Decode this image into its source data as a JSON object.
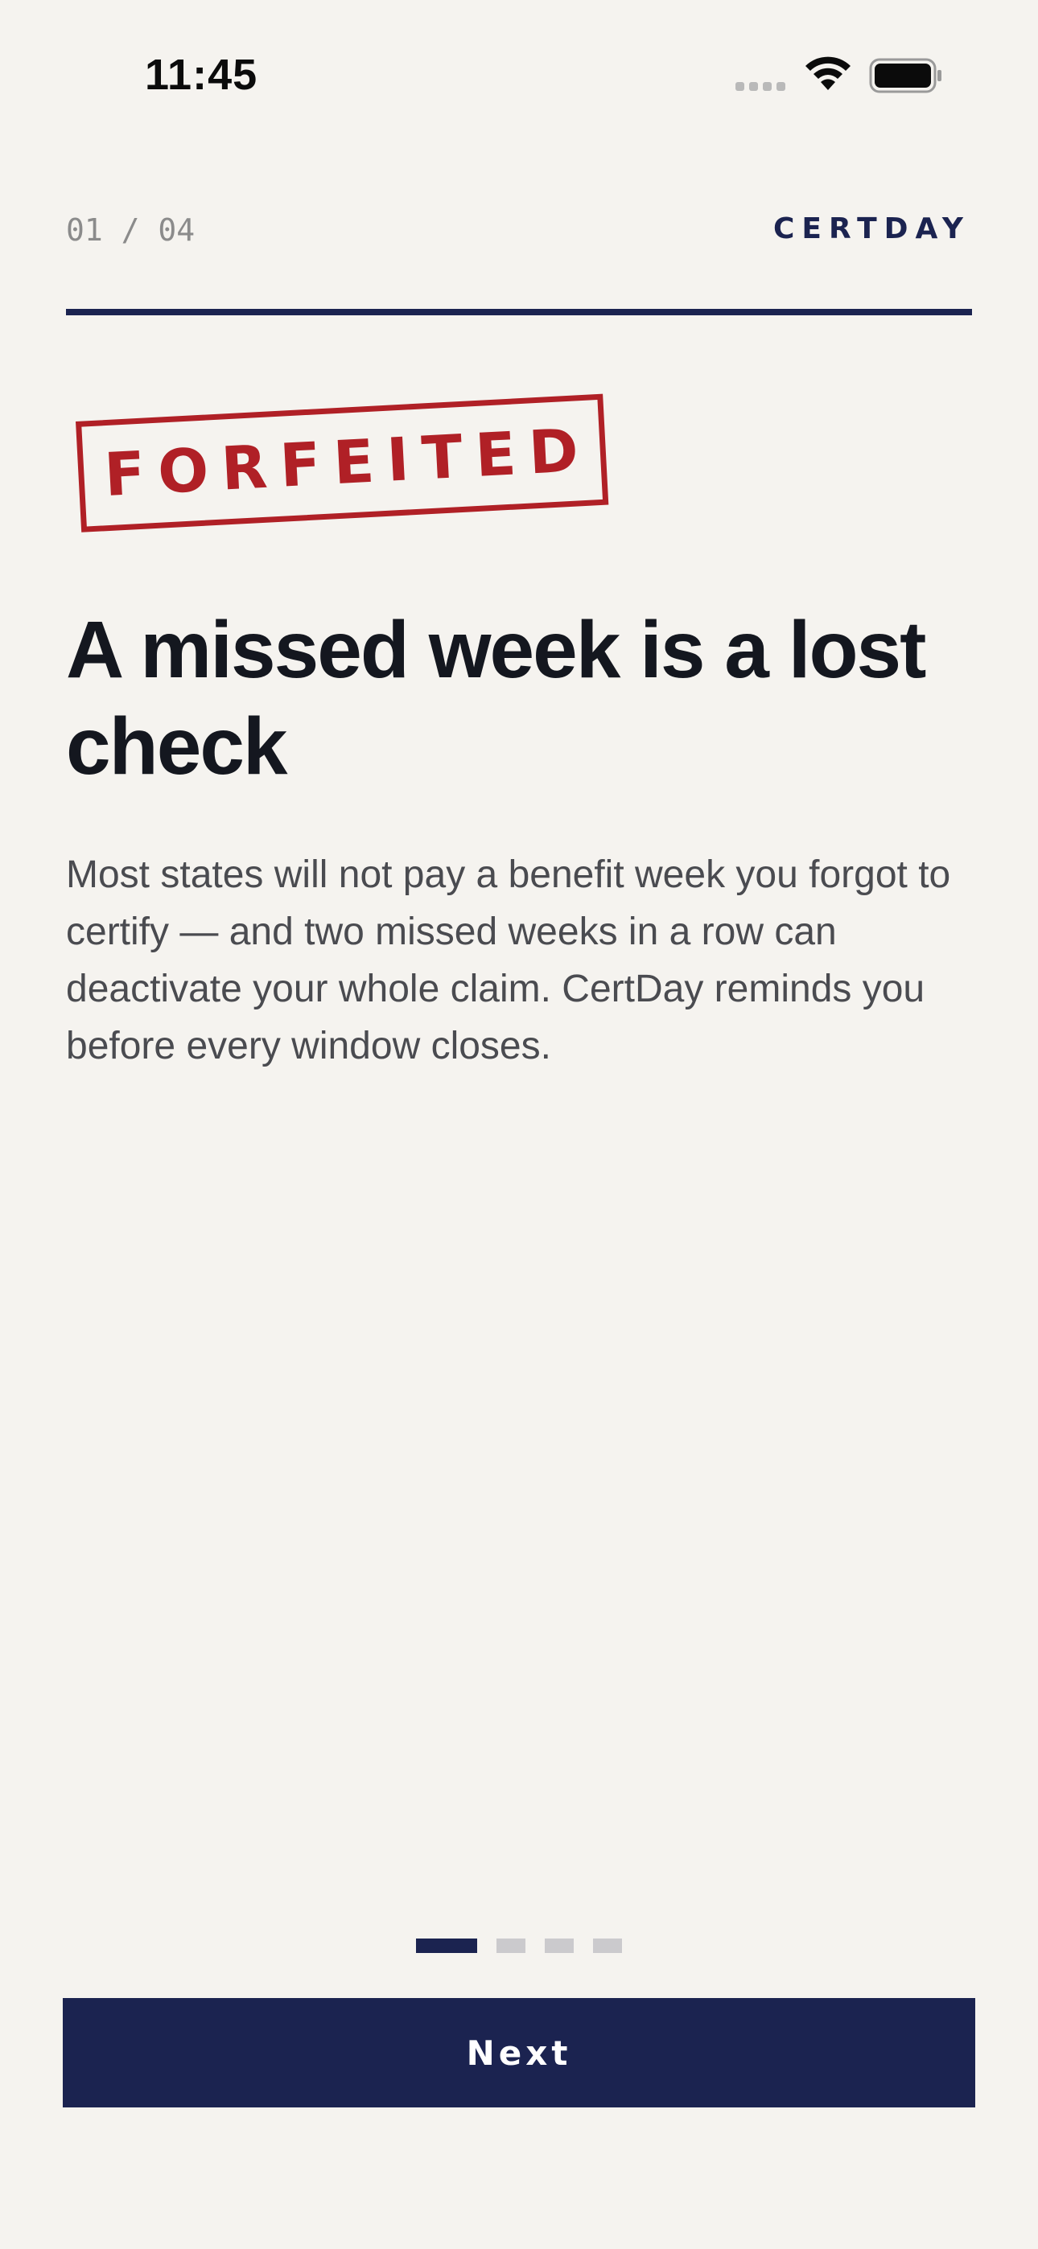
{
  "status_bar": {
    "time": "11:45",
    "signal_icon": "cellular-signal-icon",
    "wifi_icon": "wifi-icon",
    "battery_icon": "battery-icon"
  },
  "header": {
    "step_counter": "01 / 04",
    "brand": "CERTDAY"
  },
  "stamp": {
    "text": "FORFEITED",
    "color": "#b02026"
  },
  "content": {
    "headline": "A missed week is a lost check",
    "body": "Most states will not pay a benefit week you forgot to certify — and two missed weeks in a row can deactivate your whole claim. CertDay reminds you before every window closes."
  },
  "pagination": {
    "current_page": 1,
    "total_pages": 4
  },
  "footer": {
    "next_label": "Next"
  },
  "colors": {
    "background": "#f5f3ef",
    "accent": "#1b2350",
    "stamp_red": "#b02026",
    "inactive_dot": "#cbcacd"
  }
}
